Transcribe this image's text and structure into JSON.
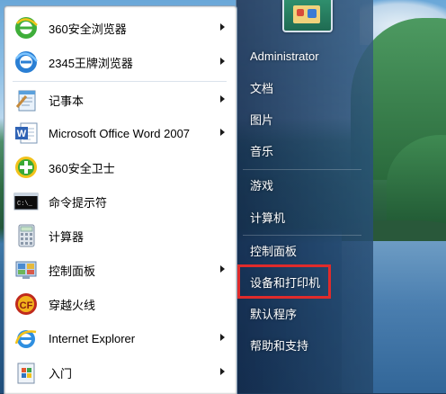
{
  "programs": [
    {
      "label": "360安全浏览器",
      "icon": "browser-360-icon",
      "has_submenu": true
    },
    {
      "label": "2345王牌浏览器",
      "icon": "browser-2345-icon",
      "has_submenu": true
    },
    {
      "label": "记事本",
      "icon": "notepad-icon",
      "has_submenu": true
    },
    {
      "label": "Microsoft Office Word 2007",
      "icon": "word-icon",
      "has_submenu": true
    },
    {
      "label": "360安全卫士",
      "icon": "security-360-icon",
      "has_submenu": false
    },
    {
      "label": "命令提示符",
      "icon": "cmd-icon",
      "has_submenu": false
    },
    {
      "label": "计算器",
      "icon": "calculator-icon",
      "has_submenu": false
    },
    {
      "label": "控制面板",
      "icon": "control-panel-icon",
      "has_submenu": true
    },
    {
      "label": "穿越火线",
      "icon": "crossfire-icon",
      "has_submenu": false
    },
    {
      "label": "Internet Explorer",
      "icon": "internet-explorer-icon",
      "has_submenu": true
    },
    {
      "label": "入门",
      "icon": "getting-started-icon",
      "has_submenu": true
    }
  ],
  "right_pane": {
    "user": "Administrator",
    "documents": "文档",
    "pictures": "图片",
    "music": "音乐",
    "games": "游戏",
    "computer": "计算机",
    "control_panel": "控制面板",
    "devices_printers": "设备和打印机",
    "default_programs": "默认程序",
    "help_support": "帮助和支持"
  },
  "colors": {
    "highlight_border": "#e02b2b",
    "menu_left_bg": "#ffffff",
    "menu_right_bg": "#1f4670"
  }
}
